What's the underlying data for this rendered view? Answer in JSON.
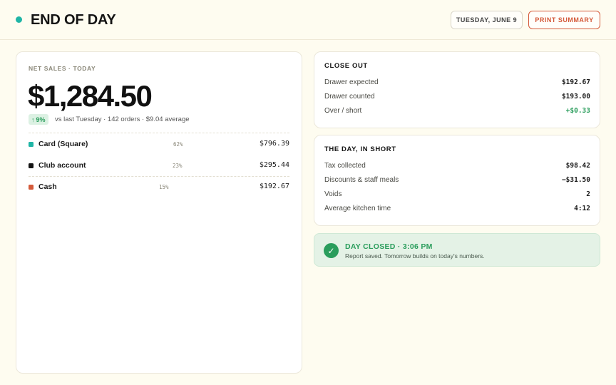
{
  "colors": {
    "accent_teal": "#1fb5a6",
    "accent_orange": "#d45a3a",
    "positive_green": "#2a9d5c",
    "swatch_card": "#1fb5a6",
    "swatch_club": "#141414",
    "swatch_cash": "#d45a3a"
  },
  "header": {
    "title": "END OF DAY",
    "date_label": "TUESDAY, JUNE 9",
    "print_label": "PRINT SUMMARY"
  },
  "sales": {
    "eyebrow": "NET SALES · TODAY",
    "total": "$1,284.50",
    "change": "9%",
    "change_icon": "arrow-up-icon",
    "change_glyph": "↑",
    "comparison": "vs last Tuesday · 142 orders · $9.04 average",
    "methods": [
      {
        "name": "Card (Square)",
        "share": "62%",
        "amount": "$796.39"
      },
      {
        "name": "Club account",
        "share": "23%",
        "amount": "$295.44"
      },
      {
        "name": "Cash",
        "share": "15%",
        "amount": "$192.67"
      }
    ]
  },
  "closeout": {
    "title": "CLOSE OUT",
    "rows": [
      {
        "label": "Drawer expected",
        "value": "$192.67"
      },
      {
        "label": "Drawer counted",
        "value": "$193.00"
      },
      {
        "label": "Over / short",
        "value": "+$0.33"
      }
    ]
  },
  "summary": {
    "title": "THE DAY, IN SHORT",
    "rows": [
      {
        "label": "Tax collected",
        "value": "$98.42"
      },
      {
        "label": "Discounts & staff meals",
        "value": "−$31.50"
      },
      {
        "label": "Voids",
        "value": "2"
      },
      {
        "label": "Average kitchen time",
        "value": "4:12"
      }
    ]
  },
  "status": {
    "icon": "check-icon",
    "icon_glyph": "✓",
    "title": "DAY CLOSED · 3:06 PM",
    "message": "Report saved. Tomorrow builds on today's numbers."
  }
}
